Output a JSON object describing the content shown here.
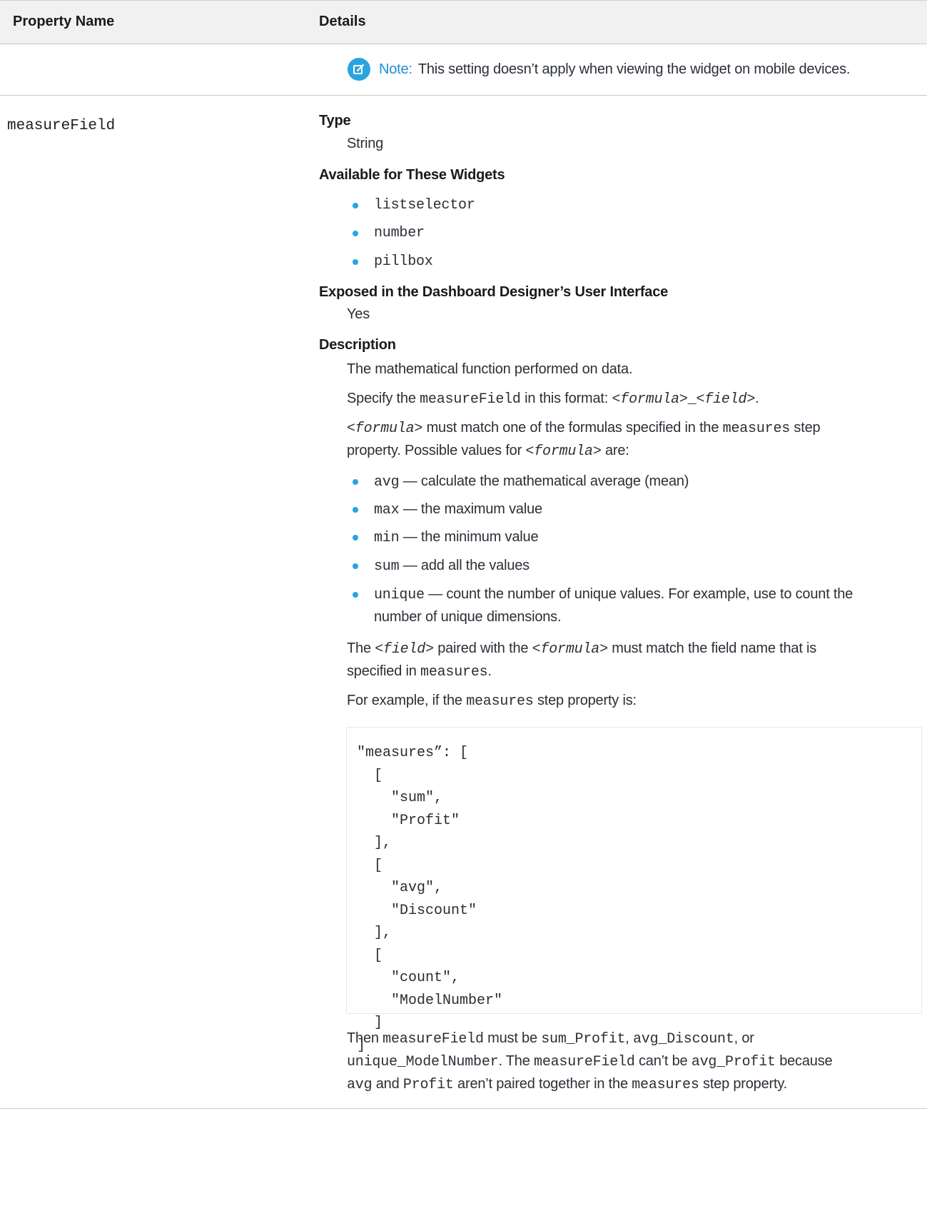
{
  "table": {
    "header": {
      "property_name": "Property Name",
      "details": "Details"
    },
    "note": {
      "label": "Note:",
      "text": "This setting doesn’t apply when viewing the widget on mobile devices."
    },
    "row": {
      "name": "measureField",
      "type_title": "Type",
      "type_value": "String",
      "widgets_title": "Available for These Widgets",
      "widgets": [
        "listselector",
        "number",
        "pillbox"
      ],
      "exposed_title": "Exposed in the Dashboard Designer’s User Interface",
      "exposed_value": "Yes",
      "description_title": "Description",
      "desc_p1": "The mathematical function performed on data.",
      "desc_p2": {
        "a": "Specify the ",
        "code": "measureField",
        "b": " in this format: ",
        "f1": "<formula>",
        "sep": "_",
        "f2": "<field>",
        "end": "."
      },
      "desc_p3": {
        "f": "<formula>",
        "a": " must match one of the formulas specified in the ",
        "code": "measures",
        "b": " step",
        "line2a": "property. Possible values for ",
        "f2": "<formula>",
        "line2b": " are:"
      },
      "formulas": [
        {
          "code": "avg",
          "text": " — calculate the mathematical average (mean)"
        },
        {
          "code": "max",
          "text": " — the maximum value"
        },
        {
          "code": "min",
          "text": " — the minimum value"
        },
        {
          "code": "sum",
          "text": " — add all the values"
        },
        {
          "code": "unique",
          "text": " — count the number of unique values. For example, use to count the",
          "text2": "number of unique dimensions."
        }
      ],
      "desc_p4": {
        "a": "The ",
        "f1": "<field>",
        "b": " paired with the ",
        "f2": "<formula>",
        "c": " must match the field name that is",
        "line2a": "specified in ",
        "code": "measures",
        "end": "."
      },
      "desc_p5": {
        "a": "For example, if the ",
        "code": "measures",
        "b": " step property is:"
      },
      "code_block": "\"measures”: [\n  [\n    \"sum\",\n    \"Profit\"\n  ],\n  [\n    \"avg\",\n    \"Discount\"\n  ],\n  [\n    \"count\",\n    \"ModelNumber\"\n  ]\n]",
      "desc_p6": {
        "a": "Then ",
        "c1": "measureField",
        "b": " must be ",
        "c2": "sum_Profit",
        "comma1": ", ",
        "c3": "avg_Discount",
        "comma2": ", or",
        "c4": "unique_ModelNumber",
        "d": ". The ",
        "c5": "measureField",
        "e": " can’t be ",
        "c6": "avg_Profit",
        "f": " because",
        "c7": "avg",
        "g": " and ",
        "c8": "Profit",
        "h": " aren’t paired together in the ",
        "c9": "measures",
        "i": " step property."
      }
    }
  },
  "colors": {
    "accent": "#2aa4de",
    "note_label": "#1c8fd6",
    "header_bg": "#f1f1f1"
  }
}
